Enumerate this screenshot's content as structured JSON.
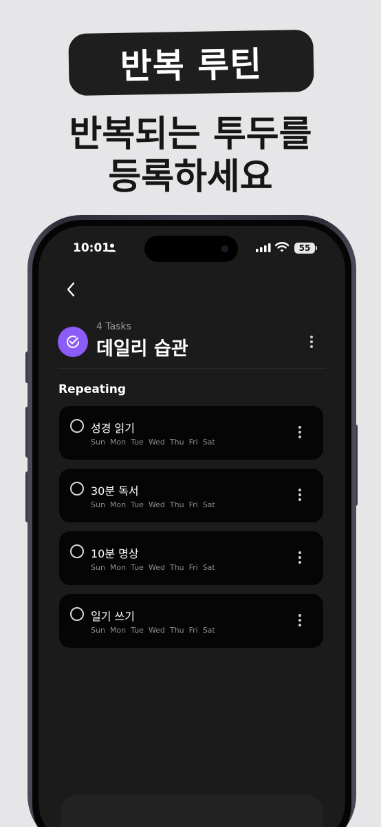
{
  "promo": {
    "badge": "반복 루틴",
    "headline_line1": "반복되는 투두를",
    "headline_line2": "등록하세요"
  },
  "status_bar": {
    "time": "10:01",
    "battery": "55",
    "icons": [
      "person-icon",
      "signal-icon",
      "wifi-icon",
      "battery-icon"
    ]
  },
  "header": {
    "task_count": "4 Tasks",
    "title": "데일리 습관",
    "icon": "check-circle-icon",
    "accent_color": "#8b5cf6"
  },
  "section": {
    "label": "Repeating"
  },
  "tasks": [
    {
      "name": "성경 읽기",
      "days": [
        "Sun",
        "Mon",
        "Tue",
        "Wed",
        "Thu",
        "Fri",
        "Sat"
      ]
    },
    {
      "name": "30분 독서",
      "days": [
        "Sun",
        "Mon",
        "Tue",
        "Wed",
        "Thu",
        "Fri",
        "Sat"
      ]
    },
    {
      "name": "10분 명상",
      "days": [
        "Sun",
        "Mon",
        "Tue",
        "Wed",
        "Thu",
        "Fri",
        "Sat"
      ]
    },
    {
      "name": "일기 쓰기",
      "days": [
        "Sun",
        "Mon",
        "Tue",
        "Wed",
        "Thu",
        "Fri",
        "Sat"
      ]
    }
  ]
}
